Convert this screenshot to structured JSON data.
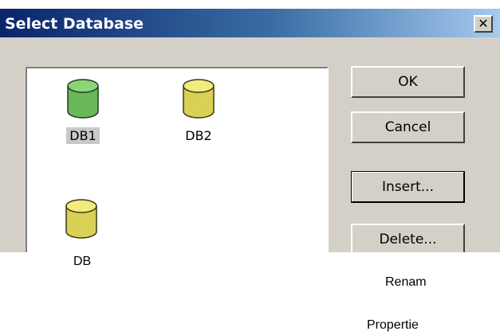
{
  "window": {
    "title": "Select Database",
    "close_glyph": "✕"
  },
  "databases": [
    {
      "label": "DB1",
      "color": "green",
      "selected": true
    },
    {
      "label": "DB2",
      "color": "yellow",
      "selected": false
    },
    {
      "label": "DB",
      "color": "yellow",
      "selected": false
    }
  ],
  "buttons": {
    "ok": "OK",
    "cancel": "Cancel",
    "insert": "Insert...",
    "delete": "Delete...",
    "rename": "Renam",
    "properties": "Propertie"
  },
  "colors": {
    "title_start": "#0a246a",
    "title_end": "#a6caf0",
    "face": "#d4d0c8",
    "db_green": "#6dbf5a",
    "db_yellow": "#e8e060"
  }
}
